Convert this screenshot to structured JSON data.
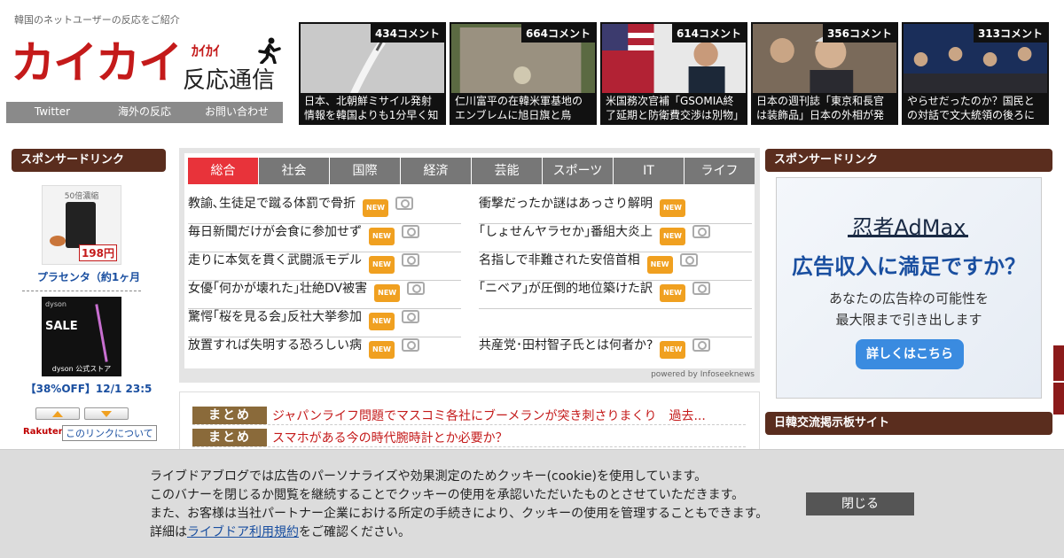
{
  "header": {
    "tagline": "韓国のネットユーザーの反応をご紹介",
    "logo_main": "カイカイ",
    "logo_kana": "ｶｲｶｲ",
    "logo_sub": "反応通信",
    "nav": [
      "Twitter",
      "海外の反応",
      "お問い合わせ"
    ]
  },
  "thumbs": [
    {
      "count": "434コメント",
      "caption": "日本、北朝鮮ミサイル発射情報を韓国よりも1分早く知ら"
    },
    {
      "count": "664コメント",
      "caption": "仁川富平の在韓米軍基地のエンブレムに旭日旗と鳥居？…"
    },
    {
      "count": "614コメント",
      "caption": "米国務次官補「GSOMIA終了延期と防衛費交渉は別物」認"
    },
    {
      "count": "356コメント",
      "caption": "日本の週刊誌「東京和長官は装飾品」日本の外相が発言し"
    },
    {
      "count": "313コメント",
      "caption": "やらせだったのか？国民との対話で文大統領の後ろに映っ"
    }
  ],
  "sidebar_left": {
    "heading": "スポンサードリンク",
    "ad1_label": "プラセンタ（約1ヶ月",
    "ad1_price": "198円",
    "ad1_top": "50倍濃縮",
    "ad2_brand": "dyson",
    "ad2_sale": "SALE",
    "ad2_store": "dyson 公式ストア",
    "ad2_label": "【38%OFF】12/1 23:5",
    "rakuten": "Rakuten",
    "about_link": "このリンクについて"
  },
  "news": {
    "tabs": [
      "総合",
      "社会",
      "国際",
      "経済",
      "芸能",
      "スポーツ",
      "IT",
      "ライフ"
    ],
    "left": [
      "教諭､生徒足で蹴る体罰で骨折",
      "毎日新聞だけが会食に参加せず",
      "走りに本気を貫く武闘派モデル",
      "女優｢何かが壊れた｣壮絶DV被害",
      "驚愕｢桜を見る会｣反社大挙参加",
      "放置すれば失明する恐ろしい病"
    ],
    "right": [
      "衝撃だったか謎はあっさり解明",
      "｢しょせんヤラセか｣番組大炎上",
      "名指しで非難された安倍首相",
      "｢ニベア｣が圧倒的地位築けた訳",
      "",
      "共産党･田村智子氏とは何者か?"
    ],
    "badge": "NEW",
    "powered": "powered by Infoseeknews"
  },
  "matome": {
    "tag": "まとめ",
    "items": [
      "ジャパンライフ問題でマスコミ各社にブーメランが突き刺さりまくり　過去...",
      "スマホがある今の時代腕時計とか必要か？"
    ]
  },
  "sidebar_right": {
    "heading1": "スポンサードリンク",
    "ad_brand": "忍者AdMax",
    "ad_headline": "広告収入に満足ですか？",
    "ad_sub1": "あなたの広告枠の可能性を",
    "ad_sub2": "最大限まで引き出します",
    "ad_button": "詳しくはこちら",
    "heading2": "日韓交流掲示板サイト"
  },
  "cookie": {
    "line1": "ライブドアブログでは広告のパーソナライズや効果測定のためクッキー(cookie)を使用しています。",
    "line2": "このバナーを閉じるか閲覧を継続することでクッキーの使用を承認いただいたものとさせていただきます。",
    "line3": "また、お客様は当社パートナー企業における所定の手続きにより、クッキーの使用を管理することもできます。",
    "line4_pre": "詳細は",
    "line4_link": "ライブドア利用規約",
    "line4_post": "をご確認ください。",
    "close": "閉じる"
  }
}
